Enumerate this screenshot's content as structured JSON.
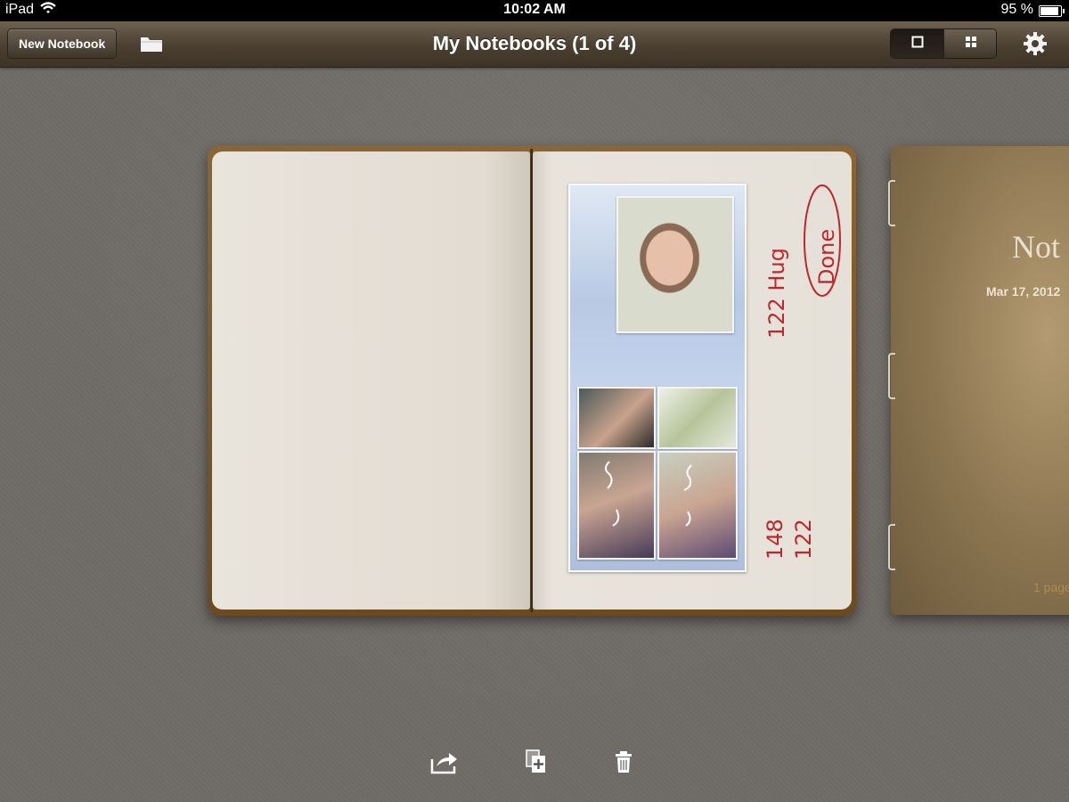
{
  "status_bar": {
    "carrier": "iPad",
    "time": "10:02 AM",
    "battery": "95 %"
  },
  "nav_bar": {
    "new_notebook_label": "New Notebook",
    "title": "My Notebooks (1 of 4)",
    "icons": {
      "folder": "folder-icon",
      "single_view": "single-view-icon",
      "grid_view": "grid-view-icon",
      "settings": "gear-icon"
    }
  },
  "notebook": {
    "handwritten_notes": [
      "122 Hug",
      "Done",
      "148",
      "122"
    ],
    "ink_color": "#c0272d"
  },
  "next_notebook": {
    "title": "Not",
    "date": "Mar 17, 2012",
    "pages": "1 page"
  },
  "bottom_toolbar": {
    "icons": [
      "share-icon",
      "duplicate-icon",
      "trash-icon"
    ]
  },
  "colors": {
    "background": "#6f6b67",
    "nav_bar": "#4a3f31",
    "book_cover": "#7a5a2c",
    "page": "#e6e1d8"
  }
}
